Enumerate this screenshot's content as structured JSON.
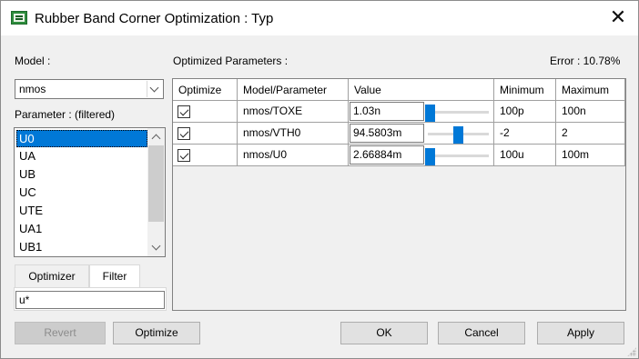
{
  "window": {
    "title": "Rubber Band Corner Optimization : Typ"
  },
  "model": {
    "label": "Model :",
    "value": "nmos"
  },
  "parameter": {
    "label": "Parameter : (filtered)",
    "items": [
      "U0",
      "UA",
      "UB",
      "UC",
      "UTE",
      "UA1",
      "UB1"
    ],
    "selected": "U0"
  },
  "tabs": {
    "optimizer": "Optimizer",
    "filter": "Filter",
    "active": "Filter"
  },
  "filter": {
    "value": "u*"
  },
  "optimized": {
    "label": "Optimized Parameters :",
    "error": "Error : 10.78%"
  },
  "grid": {
    "headers": [
      "Optimize",
      "Model/Parameter",
      "Value",
      "Minimum",
      "Maximum"
    ],
    "rows": [
      {
        "optimize": true,
        "parameter": "nmos/TOXE",
        "value": "1.03n",
        "slider_position": 0.03,
        "minimum": "100p",
        "maximum": "100n"
      },
      {
        "optimize": true,
        "parameter": "nmos/VTH0",
        "value": "94.5803m",
        "slider_position": 0.52,
        "minimum": "-2",
        "maximum": "2"
      },
      {
        "optimize": true,
        "parameter": "nmos/U0",
        "value": "2.66884m",
        "slider_position": 0.03,
        "minimum": "100u",
        "maximum": "100m"
      }
    ]
  },
  "buttons": {
    "revert": "Revert",
    "optimize": "Optimize",
    "ok": "OK",
    "cancel": "Cancel",
    "apply": "Apply"
  }
}
